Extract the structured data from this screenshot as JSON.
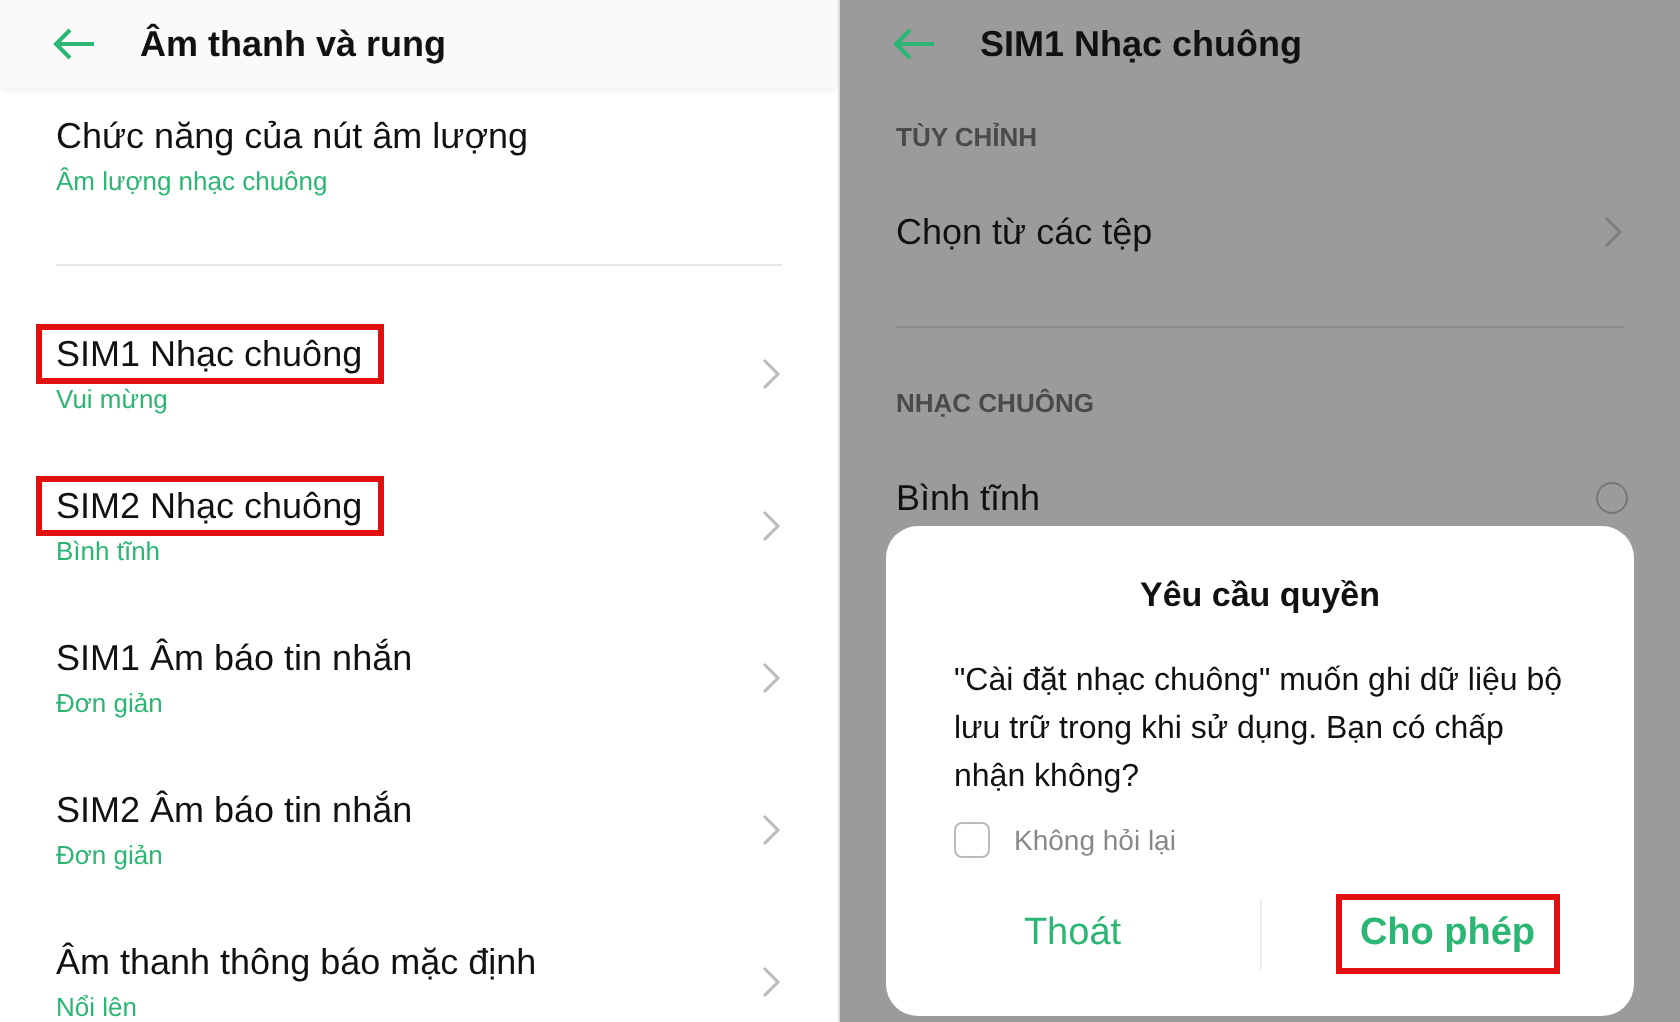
{
  "settings_screen": {
    "title": "Âm thanh và rung",
    "groups": [
      {
        "items": [
          {
            "kind": "plain",
            "title": "Chức năng của nút âm lượng",
            "value": "Âm lượng nhạc chuông",
            "highlighted": false
          }
        ]
      },
      {
        "items": [
          {
            "kind": "link",
            "title": "SIM1 Nhạc chuông",
            "value": "Vui mừng",
            "highlighted": true
          },
          {
            "kind": "link",
            "title": "SIM2 Nhạc chuông",
            "value": "Bình tĩnh",
            "highlighted": true
          },
          {
            "kind": "link",
            "title": "SIM1 Âm báo tin nhắn",
            "value": "Đơn giản",
            "highlighted": false
          },
          {
            "kind": "link",
            "title": "SIM2 Âm báo tin nhắn",
            "value": "Đơn giản",
            "highlighted": false
          },
          {
            "kind": "link",
            "title": "Âm thanh thông báo mặc định",
            "value": "Nổi lên",
            "highlighted": false
          }
        ]
      }
    ]
  },
  "ringtone_screen": {
    "title": "SIM1 Nhạc chuông",
    "sections": [
      {
        "heading": "TÙY CHỈNH",
        "items": [
          {
            "kind": "link",
            "label": "Chọn từ các tệp"
          }
        ]
      },
      {
        "heading": "NHẠC CHUÔNG",
        "items": [
          {
            "kind": "radio",
            "label": "Bình tĩnh",
            "selected": false
          }
        ]
      }
    ],
    "dialog": {
      "title": "Yêu cầu quyền",
      "message": "\"Cài đặt nhạc chuông\" muốn ghi dữ liệu bộ lưu trữ trong khi sử dụng. Bạn có chấp nhận không?",
      "checkbox": {
        "label": "Không hỏi lại",
        "checked": false
      },
      "buttons": [
        {
          "kind": "cancel",
          "label": "Thoát",
          "highlighted": false
        },
        {
          "kind": "confirm",
          "label": "Cho phép",
          "highlighted": true
        }
      ]
    }
  }
}
